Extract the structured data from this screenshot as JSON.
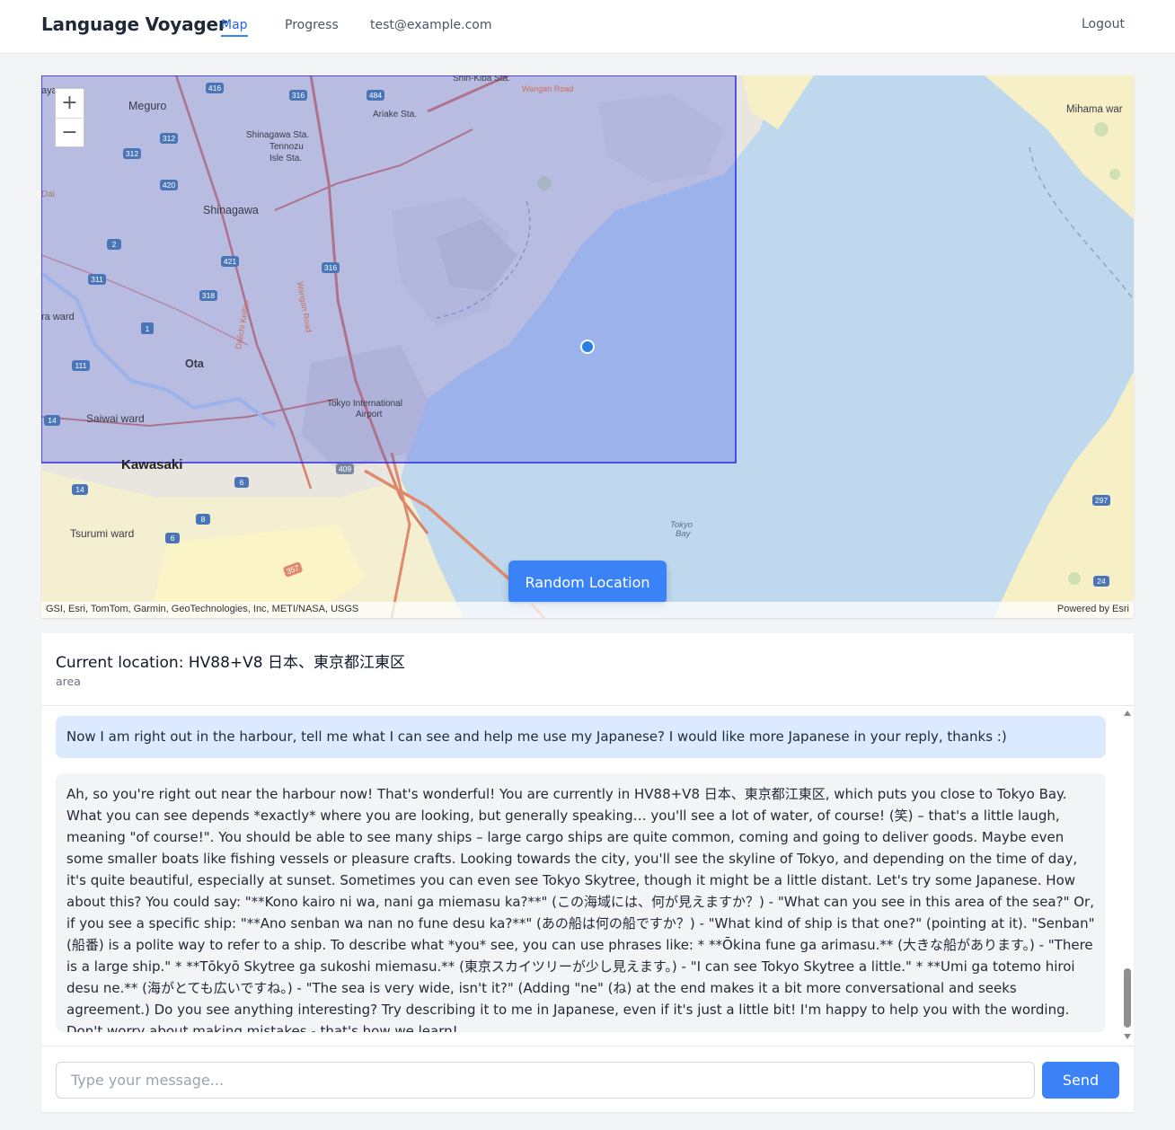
{
  "header": {
    "brand": "Language Voyager",
    "nav": {
      "map": "Map",
      "progress": "Progress",
      "email": "test@example.com"
    },
    "logout": "Logout",
    "active_color": "#3b82f6"
  },
  "map": {
    "zoom_in": "+",
    "zoom_out": "−",
    "labels": {
      "meguro": "Meguro",
      "shinagawa": "Shinagawa",
      "shinagawa_sta": "Shinagawa Sta.",
      "tennozu1": "Tennozu",
      "tennozu2": "Isle Sta.",
      "ariake": "Ariake Sta.",
      "shin_kiba": "Shin-Kiba Sta.",
      "wangan": "Wangan Road",
      "mihama": "Mihama war",
      "ota": "Ota",
      "ota_ward": "ra ward",
      "saiwai": "Saiwai ward",
      "kawasaki": "Kawasaki",
      "tsurumi": "Tsurumi ward",
      "airport1": "Tokyo International",
      "airport2": "Airport",
      "bay1": "Tokyo",
      "bay2": "Bay",
      "keihin": "Daiichi Keihin",
      "wangan_rd": "Wangan Road",
      "aya": "aya",
      "dai": "Dai"
    },
    "route_shields": [
      "416",
      "316",
      "484",
      "312",
      "312",
      "420",
      "2",
      "421",
      "316",
      "311",
      "318",
      "1",
      "111",
      "14",
      "409",
      "6",
      "14",
      "8",
      "6",
      "297",
      "24",
      "357"
    ],
    "attribution": "GSI, Esri, TomTom, Garmin, GeoTechnologies, Inc, METI/NASA, USGS",
    "powered_by": "Powered by Esri",
    "random_button": "Random Location"
  },
  "location": {
    "title": "Current location: HV88+V8 日本、東京都江東区",
    "type": "area"
  },
  "chat": {
    "messages": [
      {
        "role": "user",
        "text": "Now I am right out in the harbour, tell me what I can see and help me use my Japanese? I would like more Japanese in your reply, thanks :)"
      },
      {
        "role": "assistant",
        "text": "Ah, so you're right out near the harbour now! That's wonderful! You are currently in HV88+V8 日本、東京都江東区, which puts you close to Tokyo Bay. What you can see depends *exactly* where you are looking, but generally speaking… you'll see a lot of water, of course! (笑) – that's a little laugh, meaning \"of course!\". You should be able to see many ships – large cargo ships are quite common, coming and going to deliver goods. Maybe even some smaller boats like fishing vessels or pleasure crafts. Looking towards the city, you'll see the skyline of Tokyo, and depending on the time of day, it's quite beautiful, especially at sunset. Sometimes you can even see Tokyo Skytree, though it might be a little distant. Let's try some Japanese. How about this? You could say: \"**Kono kairo ni wa, nani ga miemasu ka?**\" (この海域には、何が見えますか？) - \"What can you see in this area of the sea?\" Or, if you see a specific ship: \"**Ano senban wa nan no fune desu ka?**\" (あの船は何の船ですか？) - \"What kind of ship is that one?\" (pointing at it). \"Senban\" (船番) is a polite way to refer to a ship. To describe what *you* see, you can use phrases like: * **Ōkina fune ga arimasu.** (大きな船があります。) - \"There is a large ship.\" * **Tōkyō Skytree ga sukoshi miemasu.** (東京スカイツリーが少し見えます。) - \"I can see Tokyo Skytree a little.\" * **Umi ga totemo hiroi desu ne.** (海がとても広いですね。) - \"The sea is very wide, isn't it?\" (Adding \"ne\" (ね) at the end makes it a bit more conversational and seeks agreement.) Do you see anything interesting? Try describing it to me in Japanese, even if it's just a little bit! I'm happy to help you with the wording. Don't worry about making mistakes - that's how we learn!"
      }
    ],
    "user_bubble_color": "#dbeafe",
    "assistant_bubble_color": "#f3f4f6",
    "input_placeholder": "Type your message...",
    "input_value": "",
    "send": "Send"
  }
}
